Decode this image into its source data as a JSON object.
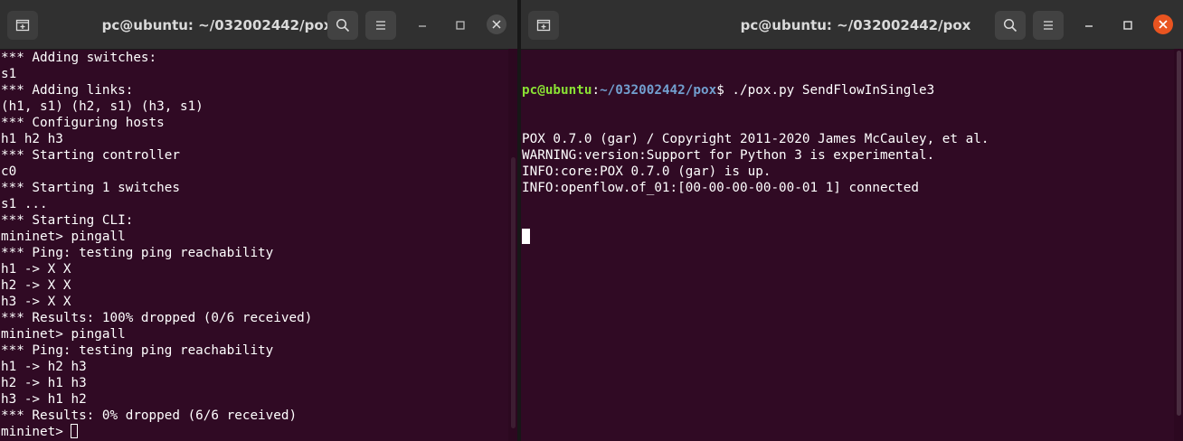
{
  "left_window": {
    "title": "pc@ubuntu: ~/032002442/pox",
    "new_tab_icon": "new-tab-icon",
    "search_icon": "search-icon",
    "menu_icon": "hamburger-menu-icon",
    "lines": [
      "*** Adding switches:",
      "s1",
      "*** Adding links:",
      "(h1, s1) (h2, s1) (h3, s1)",
      "*** Configuring hosts",
      "h1 h2 h3",
      "*** Starting controller",
      "c0",
      "*** Starting 1 switches",
      "s1 ...",
      "*** Starting CLI:",
      "mininet> pingall",
      "*** Ping: testing ping reachability",
      "h1 -> X X",
      "h2 -> X X",
      "h3 -> X X",
      "*** Results: 100% dropped (0/6 received)",
      "mininet> pingall",
      "*** Ping: testing ping reachability",
      "h1 -> h2 h3",
      "h2 -> h1 h3",
      "h3 -> h1 h2",
      "*** Results: 0% dropped (6/6 received)"
    ],
    "prompt": "mininet> "
  },
  "right_window": {
    "title": "pc@ubuntu: ~/032002442/pox",
    "prompt_user": "pc@ubuntu",
    "prompt_colon": ":",
    "prompt_path": "~/032002442/pox",
    "prompt_command": "$ ./pox.py SendFlowInSingle3",
    "lines": [
      "POX 0.7.0 (gar) / Copyright 2011-2020 James McCauley, et al.",
      "WARNING:version:Support for Python 3 is experimental.",
      "INFO:core:POX 0.7.0 (gar) is up.",
      "INFO:openflow.of_01:[00-00-00-00-00-01 1] connected"
    ]
  },
  "colors": {
    "terminal_bg": "#300a24",
    "titlebar_bg": "#303030",
    "prompt_green": "#8ae234",
    "prompt_blue": "#729fcf",
    "close_active": "#e95420"
  }
}
